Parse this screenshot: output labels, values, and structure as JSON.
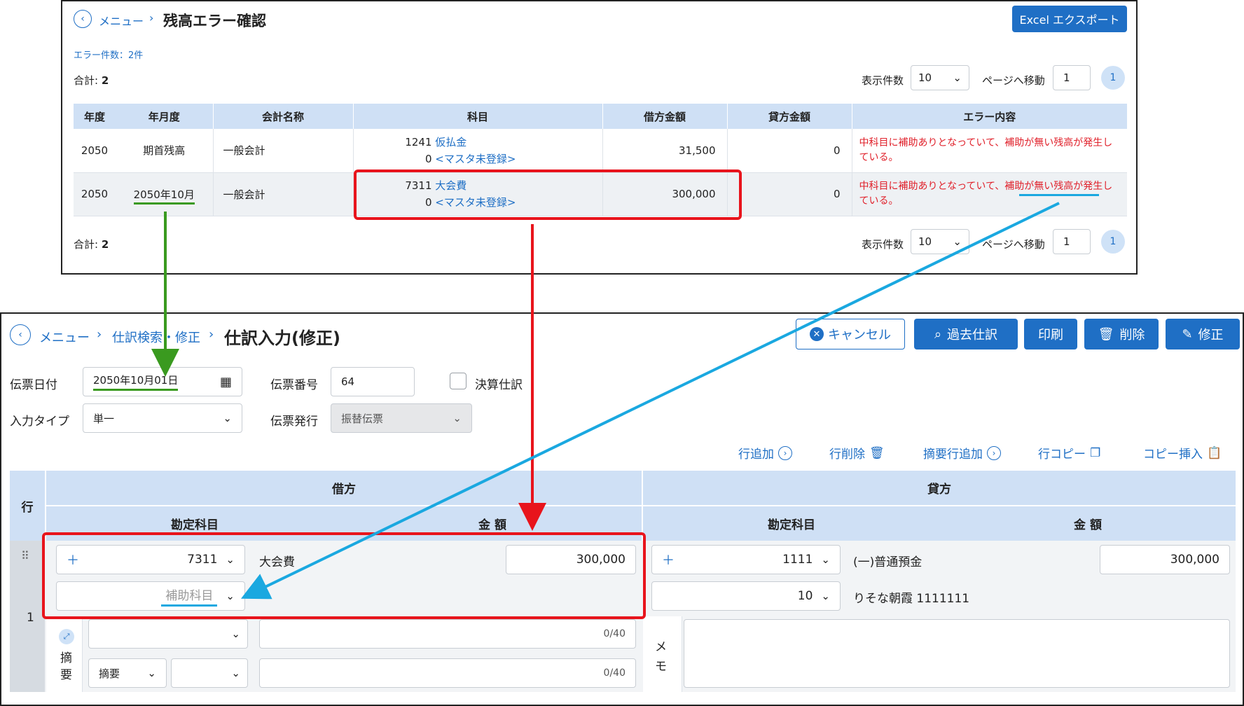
{
  "top": {
    "breadcrumb_menu": "メニュー",
    "title": "残高エラー確認",
    "export_label": "Excel エクスポート",
    "error_count": "エラー件数：2件",
    "total_label": "合計: ",
    "total_value": "2",
    "per_page_label": "表示件数",
    "per_page_value": "10",
    "goto_label": "ページへ移動",
    "goto_value": "1",
    "page": "1",
    "headers": [
      "年度",
      "年月度",
      "会計名称",
      "科目",
      "借方金額",
      "貸方金額",
      "エラー内容"
    ],
    "rows": [
      {
        "year": "2050",
        "ym": "期首残高",
        "acct": "一般会計",
        "code1": "1241",
        "name1": "仮払金",
        "code2": "0",
        "name2": "<マスタ未登録>",
        "debit": "31,500",
        "credit": "0",
        "err": "中科目に補助ありとなっていて、補助が無い残高が発生している。"
      },
      {
        "year": "2050",
        "ym": "2050年10月",
        "acct": "一般会計",
        "code1": "7311",
        "name1": "大会費",
        "code2": "0",
        "name2": "<マスタ未登録>",
        "debit": "300,000",
        "credit": "0",
        "err": "中科目に補助ありとなっていて、補助が無い残高が発生している。"
      }
    ]
  },
  "bottom": {
    "crumb_menu": "メニュー",
    "crumb_search": "仕訳検索・修正",
    "title": "仕訳入力(修正)",
    "cancel": "キャンセル",
    "past": "過去仕訳",
    "print": "印刷",
    "delete": "削除",
    "edit": "修正",
    "date_label": "伝票日付",
    "date_value": "2050年10月01日",
    "num_label": "伝票番号",
    "num_value": "64",
    "settle_label": "決算仕訳",
    "type_label": "入力タイプ",
    "type_value": "単一",
    "issue_label": "伝票発行",
    "issue_value": "振替伝票",
    "actions": [
      "行追加",
      "行削除",
      "摘要行追加",
      "行コピー",
      "コピー挿入"
    ],
    "grid": {
      "row_header": "行",
      "debit": "借方",
      "credit": "貸方",
      "acct_col": "勘定科目",
      "amt_col": "金 額",
      "row_no": "1",
      "d_code": "7311",
      "d_name": "大会費",
      "d_amount": "300,000",
      "d_sub_placeholder": "補助科目",
      "c_code": "1111",
      "c_name": "(一)普通預金",
      "c_amount": "300,000",
      "c_sub": "10",
      "c_sub_name": "りそな朝霞 1111111",
      "summary_label": "摘要",
      "summary_sel": "摘要",
      "counter1": "0/40",
      "counter2": "0/40",
      "memo_label": "メモ"
    }
  }
}
